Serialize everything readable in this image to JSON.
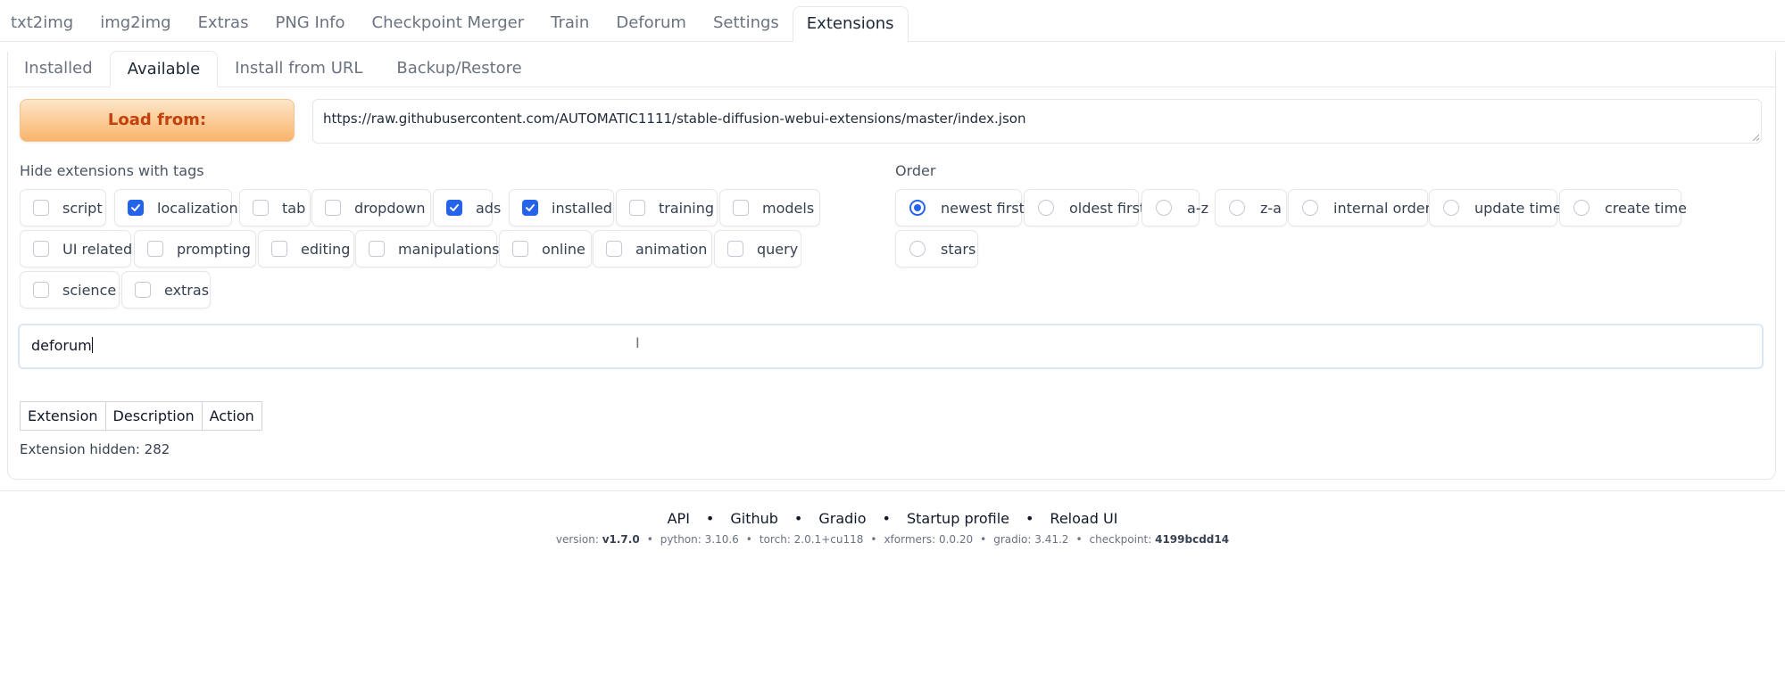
{
  "top_tabs": [
    "txt2img",
    "img2img",
    "Extras",
    "PNG Info",
    "Checkpoint Merger",
    "Train",
    "Deforum",
    "Settings",
    "Extensions"
  ],
  "active_top_tab": "Extensions",
  "sub_tabs": [
    "Installed",
    "Available",
    "Install from URL",
    "Backup/Restore"
  ],
  "active_sub_tab": "Available",
  "load_button": "Load from:",
  "url_value": "https://raw.githubusercontent.com/AUTOMATIC1111/stable-diffusion-webui-extensions/master/index.json",
  "hide_tags_label": "Hide extensions with tags",
  "tags": [
    {
      "label": "script",
      "checked": false
    },
    {
      "label": "localization",
      "checked": true
    },
    {
      "label": "tab",
      "checked": false
    },
    {
      "label": "dropdown",
      "checked": false
    },
    {
      "label": "ads",
      "checked": true
    },
    {
      "label": "installed",
      "checked": true
    },
    {
      "label": "training",
      "checked": false
    },
    {
      "label": "models",
      "checked": false
    },
    {
      "label": "UI related",
      "checked": false
    },
    {
      "label": "prompting",
      "checked": false
    },
    {
      "label": "editing",
      "checked": false
    },
    {
      "label": "manipulations",
      "checked": false
    },
    {
      "label": "online",
      "checked": false
    },
    {
      "label": "animation",
      "checked": false
    },
    {
      "label": "query",
      "checked": false
    },
    {
      "label": "science",
      "checked": false
    },
    {
      "label": "extras",
      "checked": false
    }
  ],
  "order_label": "Order",
  "order_options": [
    {
      "label": "newest first",
      "selected": true
    },
    {
      "label": "oldest first",
      "selected": false
    },
    {
      "label": "a-z",
      "selected": false
    },
    {
      "label": "z-a",
      "selected": false
    },
    {
      "label": "internal order",
      "selected": false
    },
    {
      "label": "update time",
      "selected": false
    },
    {
      "label": "create time",
      "selected": false
    },
    {
      "label": "stars",
      "selected": false
    }
  ],
  "search_value": "deforum",
  "table_headers": [
    "Extension",
    "Description",
    "Action"
  ],
  "hidden_count_text": "Extension hidden: 282",
  "footer": {
    "links": [
      "API",
      "Github",
      "Gradio",
      "Startup profile",
      "Reload UI"
    ],
    "version_items": [
      {
        "key": "version:",
        "value": "v1.7.0",
        "bold": true
      },
      {
        "key": "python:",
        "value": "3.10.6",
        "bold": false
      },
      {
        "key": "torch:",
        "value": "2.0.1+cu118",
        "bold": false
      },
      {
        "key": "xformers:",
        "value": "0.0.20",
        "bold": false
      },
      {
        "key": "gradio:",
        "value": "3.41.2",
        "bold": false
      },
      {
        "key": "checkpoint:",
        "value": "4199bcdd14",
        "bold": true
      }
    ]
  },
  "colors": {
    "accent": "#2563eb",
    "load_button_text": "#c2410c"
  }
}
